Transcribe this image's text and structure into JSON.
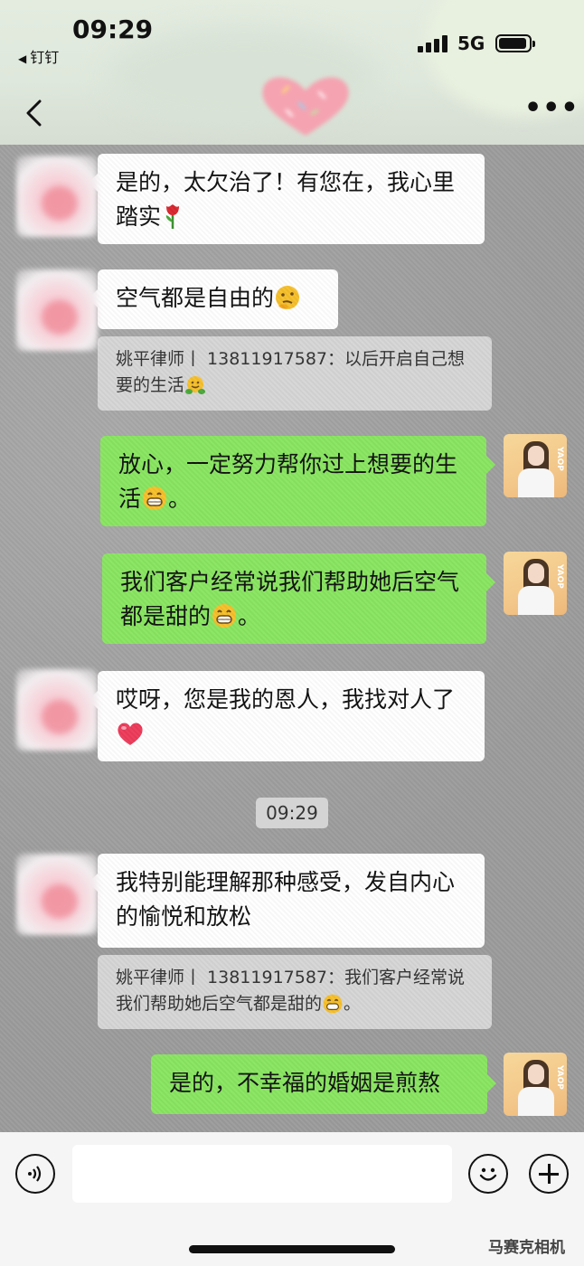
{
  "status_bar": {
    "time": "09:29",
    "back_app": "钉钉",
    "network": "5G"
  },
  "header": {
    "contact_avatar": "heart-avatar"
  },
  "messages": [
    {
      "side": "in",
      "text": "是的，太欠治了！有您在，我心里踏实",
      "emoji": "rose"
    },
    {
      "side": "in",
      "text": "空气都是自由的",
      "emoji": "thinking-face"
    },
    {
      "side": "quote",
      "text": "姚平律师丨 13811917587：以后开启自己想要的生活",
      "emoji": "hugging-face"
    },
    {
      "side": "out",
      "text": "放心，一定努力帮你过上想要的生活",
      "emoji": "grinning-face",
      "suffix": "。"
    },
    {
      "side": "out",
      "text": "我们客户经常说我们帮助她后空气都是甜的",
      "emoji": "grinning-face",
      "suffix": "。"
    },
    {
      "side": "in",
      "text": "哎呀，您是我的恩人，我找对人了",
      "emoji": "red-heart"
    },
    {
      "side": "in",
      "text": "我特别能理解那种感受，发自内心的愉悦和放松"
    },
    {
      "side": "quote",
      "text": "姚平律师丨 13811917587：我们客户经常说我们帮助她后空气都是甜的",
      "emoji": "grinning-face",
      "suffix": "。"
    },
    {
      "side": "out",
      "text": "是的，不幸福的婚姻是煎熬"
    }
  ],
  "timestamp": "09:29",
  "avatar_brand": "YAOP",
  "watermark": "马赛克相机",
  "colors": {
    "outgoing": "#89e561",
    "incoming": "#ffffff",
    "quote": "#d6d6d6"
  }
}
